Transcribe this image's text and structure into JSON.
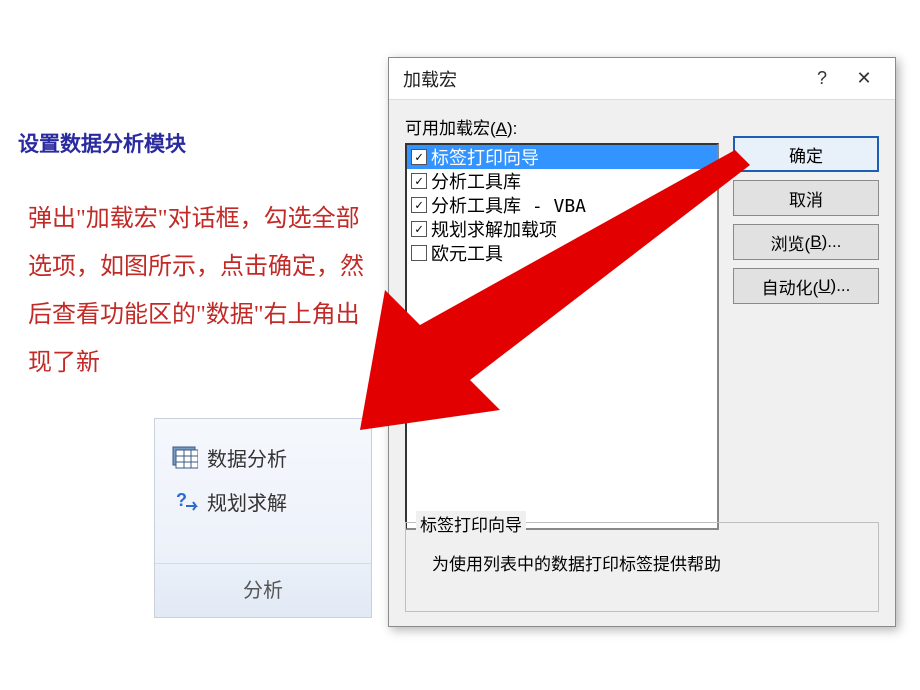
{
  "heading": "设置数据分析模块",
  "body": "弹出\"加载宏\"对话框，勾选全部选项，如图所示，点击确定，然后查看功能区的\"数据\"右上角出现了新",
  "ribbon": {
    "items": [
      {
        "label": "数据分析",
        "icon": "data-table-icon"
      },
      {
        "label": "规划求解",
        "icon": "help-arrow-icon"
      }
    ],
    "group_label": "分析"
  },
  "dialog": {
    "title": "加载宏",
    "help_char": "?",
    "close_char": "✕",
    "list_label_pre": "可用加载宏(",
    "list_label_key": "A",
    "list_label_post": "):",
    "addins": [
      {
        "label": "标签打印向导",
        "checked": true,
        "selected": true
      },
      {
        "label": "分析工具库",
        "checked": true,
        "selected": false
      },
      {
        "label": "分析工具库 - VBA",
        "checked": true,
        "selected": false
      },
      {
        "label": "规划求解加载项",
        "checked": true,
        "selected": false
      },
      {
        "label": "欧元工具",
        "checked": false,
        "selected": false
      }
    ],
    "buttons": {
      "ok": "确定",
      "cancel": "取消",
      "browse_pre": "浏览(",
      "browse_key": "B",
      "browse_post": ")...",
      "automation_pre": "自动化(",
      "automation_key": "U",
      "automation_post": ")..."
    },
    "description": {
      "legend": "标签打印向导",
      "text": "为使用列表中的数据打印标签提供帮助"
    }
  },
  "colors": {
    "arrow": "#e20000"
  }
}
